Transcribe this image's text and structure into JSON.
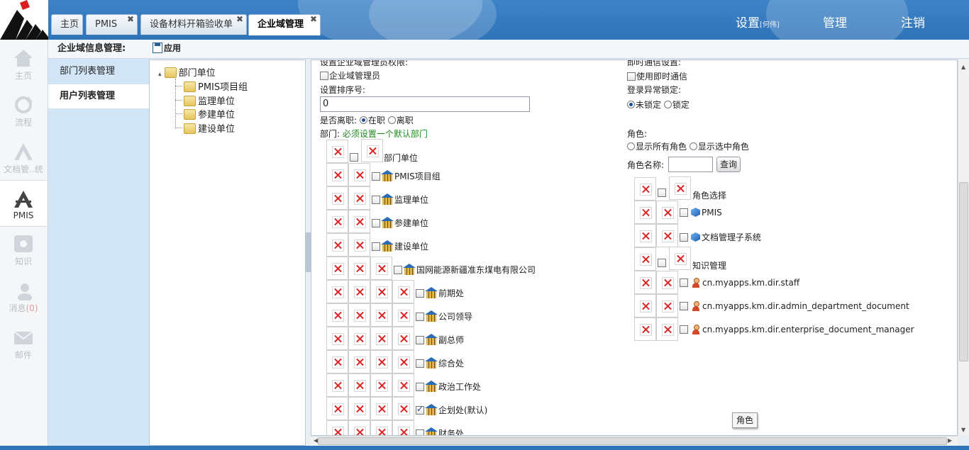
{
  "header": {
    "tabs": [
      {
        "label": "主页",
        "closable": false
      },
      {
        "label": "PMIS",
        "closable": true
      },
      {
        "label": "设备材料开箱验收单",
        "closable": true
      },
      {
        "label": "企业域管理",
        "closable": true,
        "active": true
      }
    ],
    "close_glyph": "✖",
    "settings_label": "设置",
    "settings_hint": "[何伟]",
    "manage_label": "管理",
    "logout_label": "注销"
  },
  "rail": [
    {
      "label": "主页",
      "icon": "home-icon"
    },
    {
      "label": "流程",
      "icon": "refresh-icon"
    },
    {
      "label": "文档管..统",
      "icon": "document-icon"
    },
    {
      "label": "PMIS",
      "icon": "pmis-icon",
      "active": true
    },
    {
      "label": "知识",
      "icon": "knowledge-icon"
    },
    {
      "label": "消息",
      "count": "(0)",
      "icon": "message-icon"
    },
    {
      "label": "邮件",
      "icon": "mail-icon"
    }
  ],
  "sub_menu": {
    "title": "企业域信息管理:",
    "items": [
      "部门列表管理",
      "用户列表管理"
    ]
  },
  "toolbar": {
    "apply_label": "应用"
  },
  "tree": {
    "root": "部门单位",
    "children": [
      "PMIS项目组",
      "监理单位",
      "参建单位",
      "建设单位"
    ]
  },
  "form": {
    "admin_perm_label": "设置企业域管理员权限:",
    "admin_checkbox_label": "企业域管理员",
    "order_label": "设置排序号:",
    "order_value": "0",
    "leave_label": "是否离职:",
    "leave_options": [
      "在职",
      "离职"
    ],
    "dept_label": "部门:",
    "dept_hint": "必须设置一个默认部门",
    "dept_rows": [
      {
        "label": "部门单位",
        "checked": false
      },
      {
        "label": "PMIS项目组",
        "checked": false
      },
      {
        "label": "监理单位",
        "checked": false
      },
      {
        "label": "参建单位",
        "checked": false
      },
      {
        "label": "建设单位",
        "checked": false
      },
      {
        "label": "国网能源新疆准东煤电有限公司",
        "checked": false
      },
      {
        "label": "前期处",
        "checked": false
      },
      {
        "label": "公司领导",
        "checked": false
      },
      {
        "label": "副总师",
        "checked": false
      },
      {
        "label": "综合处",
        "checked": false
      },
      {
        "label": "政治工作处",
        "checked": false
      },
      {
        "label": "企划处(默认)",
        "checked": true
      },
      {
        "label": "财务处",
        "checked": false
      }
    ],
    "im_label": "即时通信设置:",
    "im_checkbox_label": "使用即时通信",
    "lock_label": "登录异常锁定:",
    "lock_options": [
      "未锁定",
      "锁定"
    ],
    "role_label": "角色:",
    "role_filter_options": [
      "显示所有角色",
      "显示选中角色"
    ],
    "role_name_label": "角色名称:",
    "role_name_value": "",
    "query_button": "查询",
    "role_rows": [
      {
        "label": "角色选择",
        "icon": "none"
      },
      {
        "label": "PMIS",
        "icon": "gem-icon"
      },
      {
        "label": "文档管理子系统",
        "icon": "gem-icon"
      },
      {
        "label": "知识管理",
        "icon": "none"
      },
      {
        "label": "cn.myapps.km.dir.staff",
        "icon": "user-icon"
      },
      {
        "label": "cn.myapps.km.dir.admin_department_document",
        "icon": "user-icon"
      },
      {
        "label": "cn.myapps.km.dir.enterprise_document_manager",
        "icon": "user-icon"
      }
    ],
    "tooltip": "角色"
  },
  "colors": {
    "header": "#2f73b8",
    "submenu": "#d2e6f7",
    "hint": "#1d8a1d"
  }
}
